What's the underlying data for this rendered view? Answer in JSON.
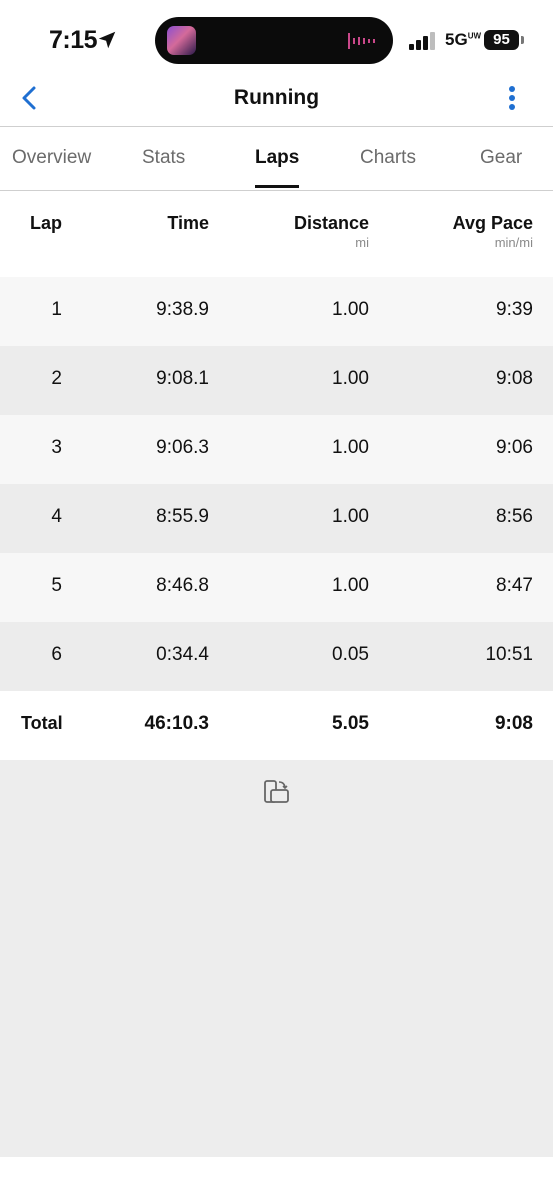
{
  "status_bar": {
    "time": "7:15",
    "network": "5G",
    "battery": "95"
  },
  "header": {
    "title": "Running",
    "back_icon": "chevron-left-icon",
    "more_icon": "more-vertical-icon",
    "accent_color": "#1f6fd1"
  },
  "tabs": [
    {
      "label": "Overview",
      "active": false
    },
    {
      "label": "Stats",
      "active": false
    },
    {
      "label": "Laps",
      "active": true
    },
    {
      "label": "Charts",
      "active": false
    },
    {
      "label": "Gear",
      "active": false
    }
  ],
  "table": {
    "columns": [
      {
        "label": "Lap",
        "unit": ""
      },
      {
        "label": "Time",
        "unit": ""
      },
      {
        "label": "Distance",
        "unit": "mi"
      },
      {
        "label": "Avg Pace",
        "unit": "min/mi"
      }
    ],
    "rows": [
      {
        "lap": "1",
        "time": "9:38.9",
        "distance": "1.00",
        "pace": "9:39"
      },
      {
        "lap": "2",
        "time": "9:08.1",
        "distance": "1.00",
        "pace": "9:08"
      },
      {
        "lap": "3",
        "time": "9:06.3",
        "distance": "1.00",
        "pace": "9:06"
      },
      {
        "lap": "4",
        "time": "8:55.9",
        "distance": "1.00",
        "pace": "8:56"
      },
      {
        "lap": "5",
        "time": "8:46.8",
        "distance": "1.00",
        "pace": "8:47"
      },
      {
        "lap": "6",
        "time": "0:34.4",
        "distance": "0.05",
        "pace": "10:51"
      }
    ],
    "total": {
      "label": "Total",
      "time": "46:10.3",
      "distance": "5.05",
      "pace": "9:08"
    }
  },
  "footer": {
    "rotate_icon": "rotate-device-icon"
  }
}
